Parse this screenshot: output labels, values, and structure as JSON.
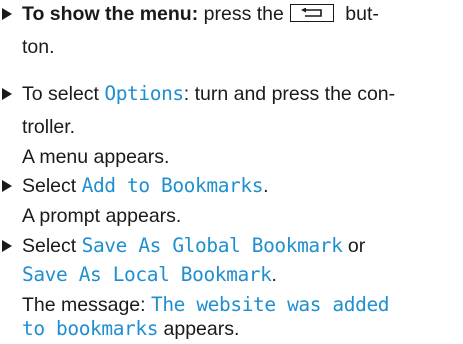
{
  "steps": [
    {
      "lines": [
        {
          "bold": "To show the menu:",
          "text_a": " press the",
          "text_b": " but-"
        },
        {
          "text": "ton."
        }
      ],
      "icons": [
        "back-button-key-icon"
      ]
    },
    {
      "lines": [
        {
          "text_a": "To select ",
          "mono": "Options",
          "text_b": ": turn and press the con-"
        },
        {
          "text": "troller."
        },
        {
          "text": "A menu appears."
        }
      ]
    },
    {
      "lines": [
        {
          "text_a": "Select ",
          "mono": "Add to Bookmarks",
          "text_b": "."
        },
        {
          "text": "A prompt appears."
        }
      ]
    },
    {
      "lines": [
        {
          "text_a": "Select ",
          "mono": "Save As Global Bookmark",
          "text_b": " or"
        },
        {
          "mono": "Save As Local Bookmark",
          "text_b": "."
        },
        {
          "text_a": "The message: ",
          "mono": "The website was added"
        },
        {
          "mono": "to bookmarks",
          "text_b": " appears."
        }
      ]
    }
  ],
  "colors": {
    "text": "#1a1a1a",
    "display_text": "#1f8fd0"
  }
}
